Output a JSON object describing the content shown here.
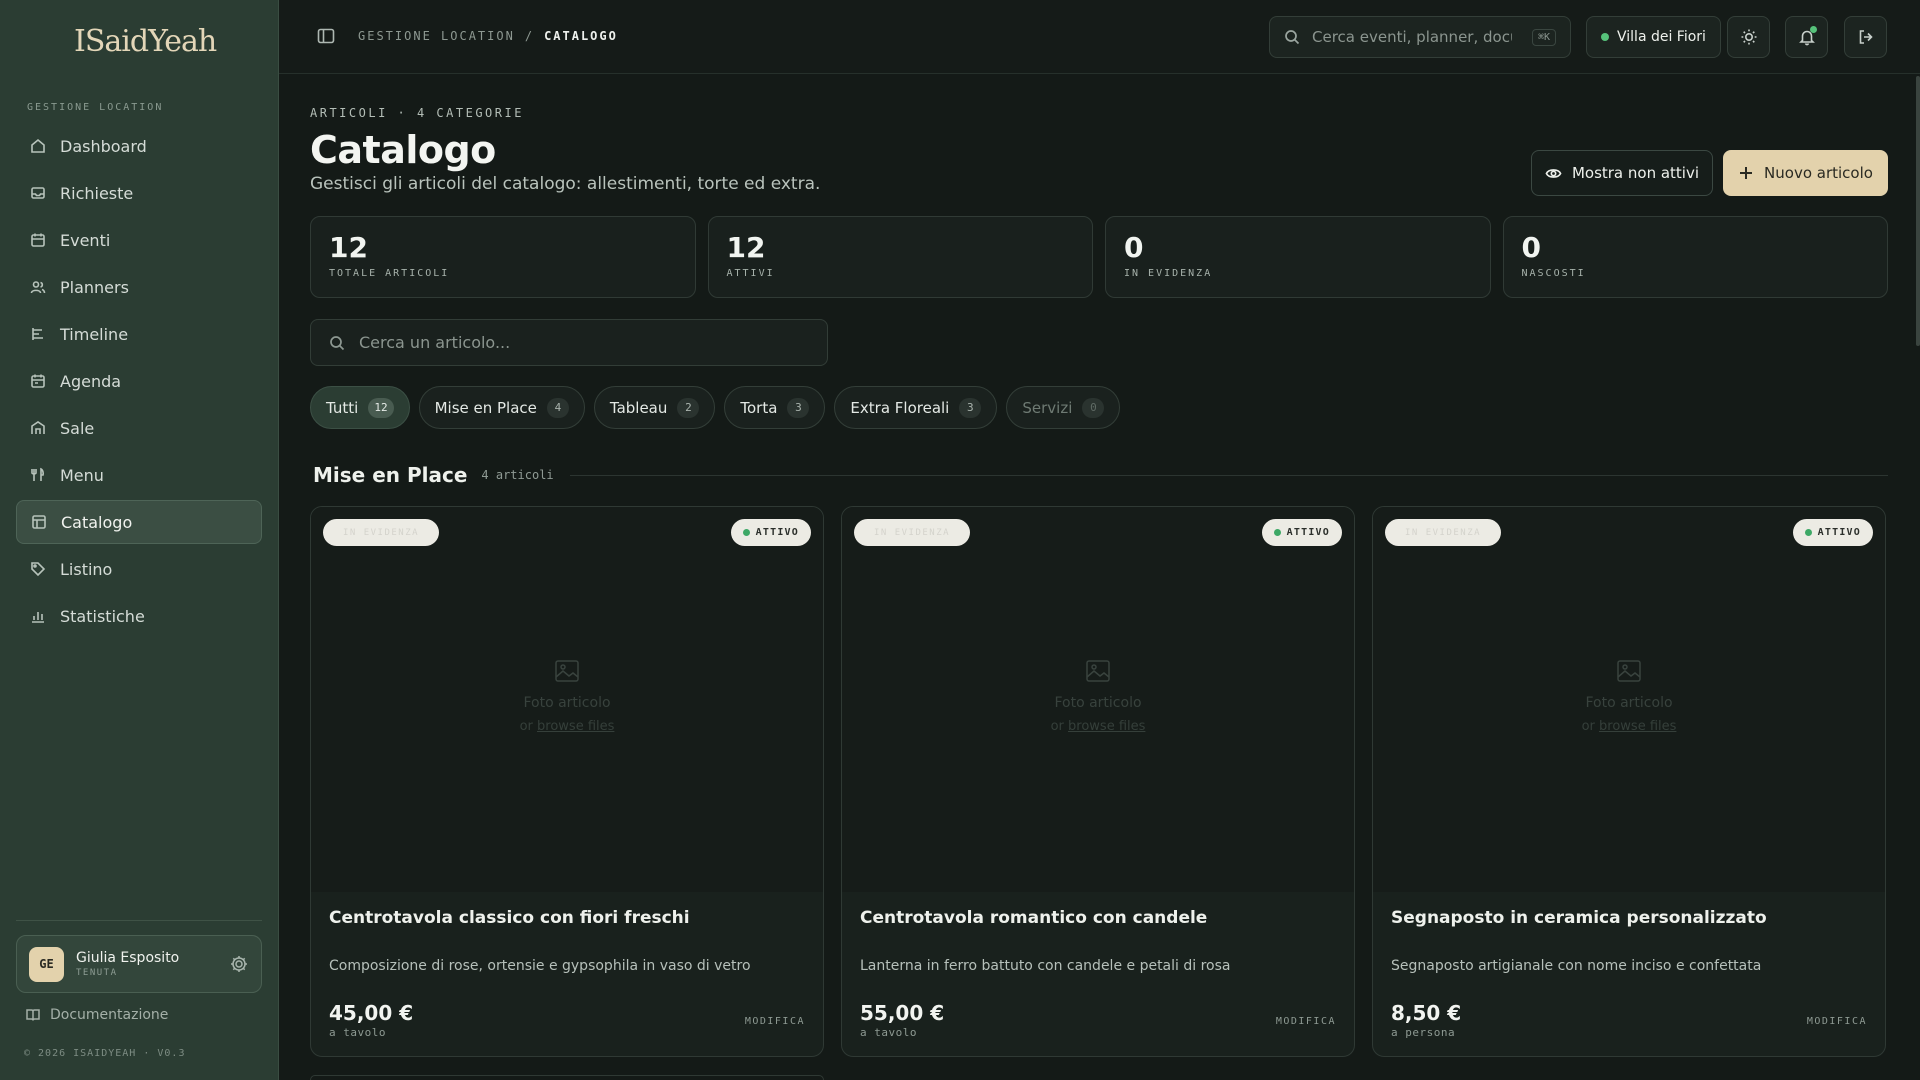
{
  "app": {
    "logo_text": "ISaidYeah",
    "sidebar_section": "GESTIONE LOCATION"
  },
  "sidebar": {
    "items": [
      {
        "label": "Dashboard",
        "icon": "home-icon"
      },
      {
        "label": "Richieste",
        "icon": "inbox-icon"
      },
      {
        "label": "Eventi",
        "icon": "calendar-icon"
      },
      {
        "label": "Planners",
        "icon": "users-icon"
      },
      {
        "label": "Timeline",
        "icon": "timeline-icon"
      },
      {
        "label": "Agenda",
        "icon": "agenda-icon"
      },
      {
        "label": "Sale",
        "icon": "building-icon"
      },
      {
        "label": "Menu",
        "icon": "utensils-icon"
      },
      {
        "label": "Catalogo",
        "icon": "catalog-icon",
        "active": true
      },
      {
        "label": "Listino",
        "icon": "tag-icon"
      },
      {
        "label": "Statistiche",
        "icon": "bar-chart-icon"
      }
    ],
    "user": {
      "initials": "GE",
      "name": "Giulia Esposito",
      "role": "TENUTA"
    },
    "docs_label": "Documentazione",
    "copyright": "© 2026 ISAIDYEAH · V0.3"
  },
  "topbar": {
    "breadcrumb_root": "GESTIONE LOCATION",
    "breadcrumb_sep": "/",
    "breadcrumb_current": "CATALOGO",
    "search_placeholder": "Cerca eventi, planner, docu...",
    "search_shortcut": "⌘K",
    "venue": "Villa dei Fiori"
  },
  "page": {
    "eyebrow": "ARTICOLI · 4 CATEGORIE",
    "title": "Catalogo",
    "subtitle": "Gestisci gli articoli del catalogo: allestimenti, torte ed extra.",
    "show_inactive_label": "Mostra non attivi",
    "new_item_label": "Nuovo articolo"
  },
  "stats": [
    {
      "value": "12",
      "label": "TOTALE ARTICOLI"
    },
    {
      "value": "12",
      "label": "ATTIVI"
    },
    {
      "value": "0",
      "label": "IN EVIDENZA"
    },
    {
      "value": "0",
      "label": "NASCOSTI"
    }
  ],
  "article_search_placeholder": "Cerca un articolo...",
  "filters": [
    {
      "label": "Tutti",
      "count": "12",
      "active": true
    },
    {
      "label": "Mise en Place",
      "count": "4"
    },
    {
      "label": "Tableau",
      "count": "2"
    },
    {
      "label": "Torta",
      "count": "3"
    },
    {
      "label": "Extra Floreali",
      "count": "3"
    },
    {
      "label": "Servizi",
      "count": "0",
      "muted": true
    }
  ],
  "section": {
    "title": "Mise en Place",
    "count": "4 articoli"
  },
  "card_common": {
    "featured_tag": "IN EVIDENZA",
    "status_tag": "ATTIVO",
    "photo_label": "Foto articolo",
    "photo_hint_prefix": "or",
    "photo_hint_link": "browse files",
    "edit_label": "MODIFICA"
  },
  "cards": [
    {
      "title": "Centrotavola classico con fiori freschi",
      "desc": "Composizione di rose, ortensie e gypsophila in vaso di vetro",
      "price": "45,00 €",
      "unit": "a tavolo"
    },
    {
      "title": "Centrotavola romantico con candele",
      "desc": "Lanterna in ferro battuto con candele e petali di rosa",
      "price": "55,00 €",
      "unit": "a tavolo"
    },
    {
      "title": "Segnaposto in ceramica personalizzato",
      "desc": "Segnaposto artigianale con nome inciso e confettata",
      "price": "8,50 €",
      "unit": "a persona"
    }
  ],
  "colors": {
    "sidebar_bg": "#2b3d33",
    "page_bg": "#141a17",
    "accent": "#e3d2ac",
    "status_green": "#56c27a"
  }
}
